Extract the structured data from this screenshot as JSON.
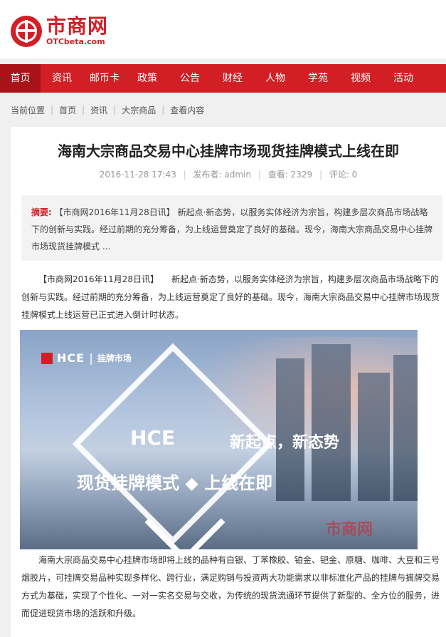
{
  "site": {
    "name_cn": "市商网",
    "domain": "OTCbeta.com",
    "brand_color": "#d21f26"
  },
  "nav": {
    "items": [
      {
        "label": "首页",
        "active": true
      },
      {
        "label": "资讯",
        "active": false
      },
      {
        "label": "邮币卡",
        "active": false
      },
      {
        "label": "政策",
        "active": false
      },
      {
        "label": "公告",
        "active": false
      },
      {
        "label": "财经",
        "active": false
      },
      {
        "label": "人物",
        "active": false
      },
      {
        "label": "学苑",
        "active": false
      },
      {
        "label": "视频",
        "active": false
      },
      {
        "label": "活动",
        "active": false
      }
    ]
  },
  "breadcrumb": {
    "prefix": "当前位置",
    "items": [
      "首页",
      "资讯",
      "大宗商品",
      "查看内容"
    ]
  },
  "article": {
    "title": "海南大宗商品交易中心挂牌市场现货挂牌模式上线在即",
    "date": "2016-11-28 17:43",
    "author": "发布者: admin",
    "views": "查看: 2329",
    "comments": "评论: 0",
    "summary_label": "摘要:",
    "summary_text": "【市商网2016年11月28日讯】 新起点·新态势，以服务实体经济为宗旨，构建多层次商品市场战略下的创新与实践。经过前期的充分筹备，为上线运营奠定了良好的基础。现今，海南大宗商品交易中心挂牌市场现货挂牌模式 ...",
    "paragraph1": "【市商网2016年11月28日讯】　　新起点·新态势，以服务实体经济为宗旨，构建多层次商品市场战略下的创新与实践。经过前期的充分筹备，为上线运营奠定了良好的基础。现今，海南大宗商品交易中心挂牌市场现货挂牌模式上线运营已正式进入倒计时状态。",
    "paragraph2": "海南大宗商品交易中心挂牌市场即将上线的品种有白银、丁苯橡胶、铂金、钯金、原糖、咖啡、大豆和三号烟胶片，可挂牌交易品种实现多样化、跨行业，满足购销与投资两大功能需求以非标准化产品的挂牌与摘牌交易方式为基础，实现了个性化、一对一实名交易与交收，为传统的现货流通环节提供了新型的、全方位的服务，进而促进现货市场的活跃和升级。"
  },
  "banner": {
    "logo_name": "HCE",
    "logo_divider": "|",
    "logo_sub": "挂牌市场",
    "big_text": "HCE",
    "slogan": "新起点，新态势",
    "headline": "现货挂牌模式 ◆ 上线在即",
    "watermark": "市商网"
  }
}
